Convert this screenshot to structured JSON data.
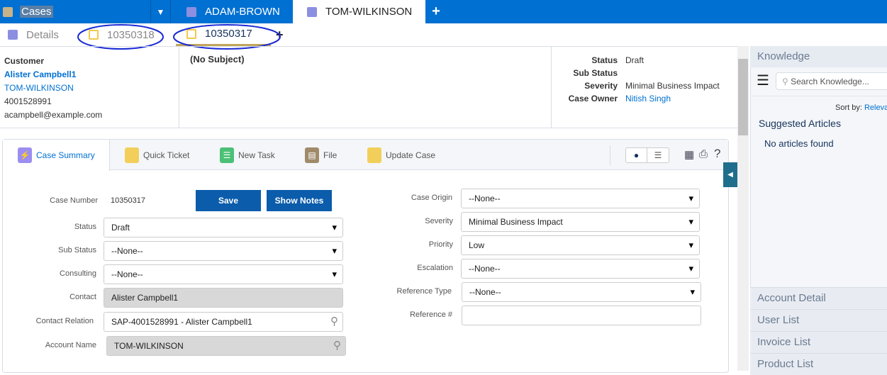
{
  "top_tabs": {
    "cases": "Cases",
    "tab1": "ADAM-BROWN",
    "tab2": "TOM-WILKINSON",
    "add": "+"
  },
  "sub_tabs": {
    "details": "Details",
    "case1": "10350318",
    "case2": "10350317",
    "add": "+"
  },
  "header": {
    "customer_label": "Customer",
    "customer_name": "Alister Campbell1",
    "account": "TOM-WILKINSON",
    "phone": "4001528991",
    "email": "acampbell@example.com",
    "subject": "(No Subject)",
    "status_label": "Status",
    "status": "Draft",
    "sub_status_label": "Sub Status",
    "sub_status": "",
    "severity_label": "Severity",
    "severity": "Minimal Business Impact",
    "owner_label": "Case Owner",
    "owner": "Nitish Singh"
  },
  "actions": {
    "case_summary": "Case Summary",
    "quick_ticket": "Quick Ticket",
    "new_task": "New Task",
    "file": "File",
    "update_case": "Update Case"
  },
  "form": {
    "case_number_label": "Case Number",
    "case_number": "10350317",
    "save": "Save",
    "show_notes": "Show Notes",
    "status_label": "Status",
    "status": "Draft",
    "sub_status_label": "Sub Status",
    "sub_status": "--None--",
    "consulting_label": "Consulting",
    "consulting": "--None--",
    "contact_label": "Contact",
    "contact": "Alister Campbell1",
    "contact_relation_label": "Contact Relation",
    "contact_relation": "SAP-4001528991 - Alister Campbell1",
    "account_name_label": "Account Name",
    "account_name": "TOM-WILKINSON",
    "case_origin_label": "Case Origin",
    "case_origin": "--None--",
    "severity_label": "Severity",
    "severity": "Minimal Business Impact",
    "priority_label": "Priority",
    "priority": "Low",
    "escalation_label": "Escalation",
    "escalation": "--None--",
    "reference_type_label": "Reference Type",
    "reference_type": "--None--",
    "reference_no_label": "Reference #",
    "reference_no": ""
  },
  "knowledge": {
    "title": "Knowledge",
    "search_placeholder": "Search Knowledge...",
    "sort_by": "Sort by:",
    "sort_value": "Relevance",
    "suggested": "Suggested Articles",
    "none": "No articles found",
    "lists": [
      "Account Detail",
      "User List",
      "Invoice List",
      "Product List"
    ]
  }
}
